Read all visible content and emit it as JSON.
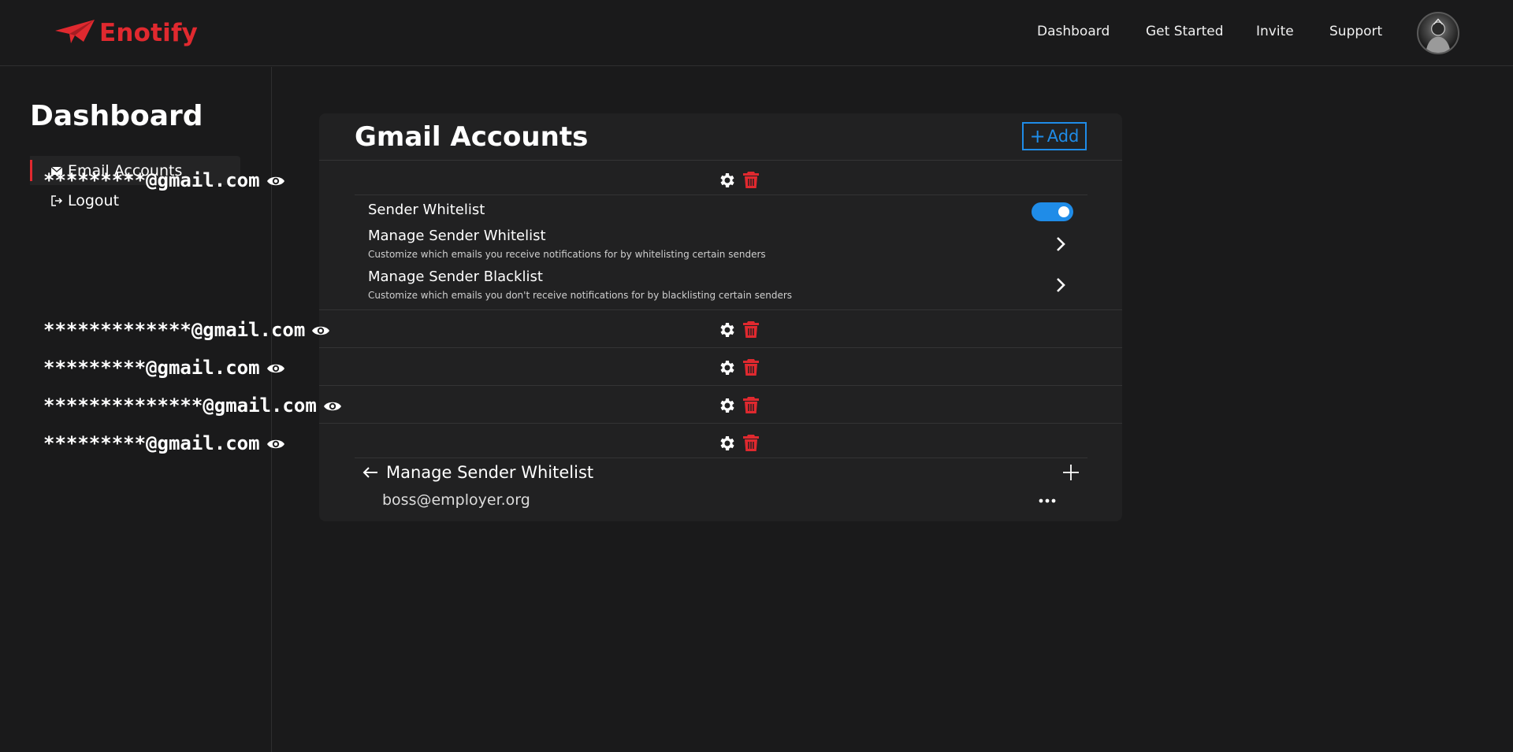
{
  "brand": {
    "name": "Enotify",
    "color": "#e0292f",
    "logo_icon": "paper-plane-icon"
  },
  "nav": {
    "items": [
      "Dashboard",
      "Get Started",
      "Invite",
      "Support"
    ],
    "avatar_icon": "user-avatar"
  },
  "sidebar": {
    "title": "Dashboard",
    "items": [
      {
        "label": "Email Accounts",
        "icon": "envelope-icon",
        "active": true
      },
      {
        "label": "Logout",
        "icon": "logout-icon",
        "active": false
      }
    ]
  },
  "main": {
    "title": "Gmail Accounts",
    "add_button": {
      "plus": "+",
      "label": "Add"
    },
    "accounts": [
      {
        "email": "*********@gmail.com",
        "expanded": true
      },
      {
        "email": "*************@gmail.com",
        "expanded": false
      },
      {
        "email": "*********@gmail.com",
        "expanded": false
      },
      {
        "email": "**************@gmail.com",
        "expanded": false
      },
      {
        "email": "*********@gmail.com",
        "expanded": true
      }
    ],
    "settings": {
      "sender_whitelist_label": "Sender Whitelist",
      "sender_whitelist_enabled": true,
      "manage_whitelist": {
        "label": "Manage Sender Whitelist",
        "description": "Customize which emails you receive notifications for by whitelisting certain senders"
      },
      "manage_blacklist": {
        "label": "Manage Sender Blacklist",
        "description": "Customize which emails you don't receive notifications for by blacklisting certain senders"
      }
    },
    "whitelist_panel": {
      "title": "Manage Sender Whitelist",
      "entries": [
        "boss@employer.org"
      ]
    }
  },
  "colors": {
    "accent": "#1f8ce8",
    "danger": "#e0292f",
    "background": "#1a1a1b",
    "card": "#212122"
  }
}
